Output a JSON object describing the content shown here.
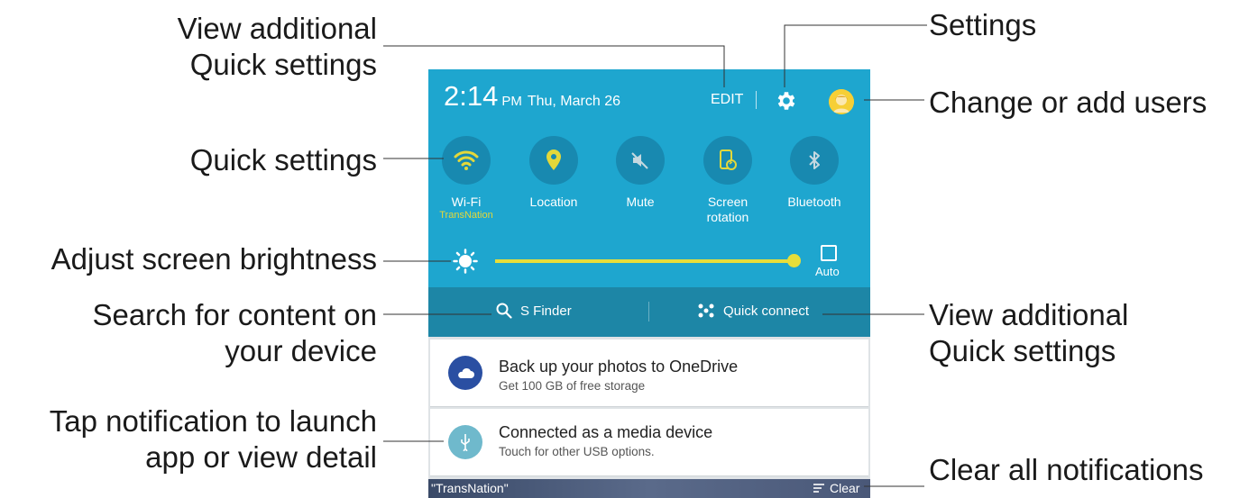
{
  "callouts": {
    "view_additional_top": "View additional\nQuick settings",
    "settings": "Settings",
    "quick_settings": "Quick settings",
    "change_users": "Change or add users",
    "adjust_brightness": "Adjust screen brightness",
    "search_content": "Search for content on\nyour device",
    "view_additional_right": "View additional\nQuick settings",
    "tap_notification": "Tap notification to launch\napp or view detail",
    "clear_all": "Clear all notifications"
  },
  "status": {
    "time": "2:14",
    "ampm": "PM",
    "date": "Thu, March 26",
    "edit_label": "EDIT"
  },
  "toggles": [
    {
      "label": "Wi-Fi",
      "sub": "TransNation",
      "icon": "wifi-icon",
      "active": true
    },
    {
      "label": "Location",
      "sub": "",
      "icon": "location-icon",
      "active": true
    },
    {
      "label": "Mute",
      "sub": "",
      "icon": "mute-icon",
      "active": false
    },
    {
      "label": "Screen\nrotation",
      "sub": "",
      "icon": "screen-rotation-icon",
      "active": true
    },
    {
      "label": "Bluetooth",
      "sub": "",
      "icon": "bluetooth-icon",
      "active": false
    }
  ],
  "brightness": {
    "level": 0.99,
    "auto_label": "Auto"
  },
  "finder": {
    "s_finder_label": "S Finder",
    "quick_connect_label": "Quick connect"
  },
  "notifications": [
    {
      "title": "Back up your photos to OneDrive",
      "subtitle": "Get 100 GB of free storage",
      "icon": "onedrive-icon"
    },
    {
      "title": "Connected as a media device",
      "subtitle": "Touch for other USB options.",
      "icon": "usb-icon"
    }
  ],
  "bottom": {
    "network_name": "\"TransNation\"",
    "clear_label": "Clear"
  },
  "colors": {
    "panel_bg": "#1ea6cf",
    "toggle_bg": "#1889b0",
    "active_yellow": "#e3d83a",
    "finder_bg": "#1d86a6",
    "onedrive_blue": "#2a4fa2",
    "usb_teal": "#6fb9cc"
  }
}
